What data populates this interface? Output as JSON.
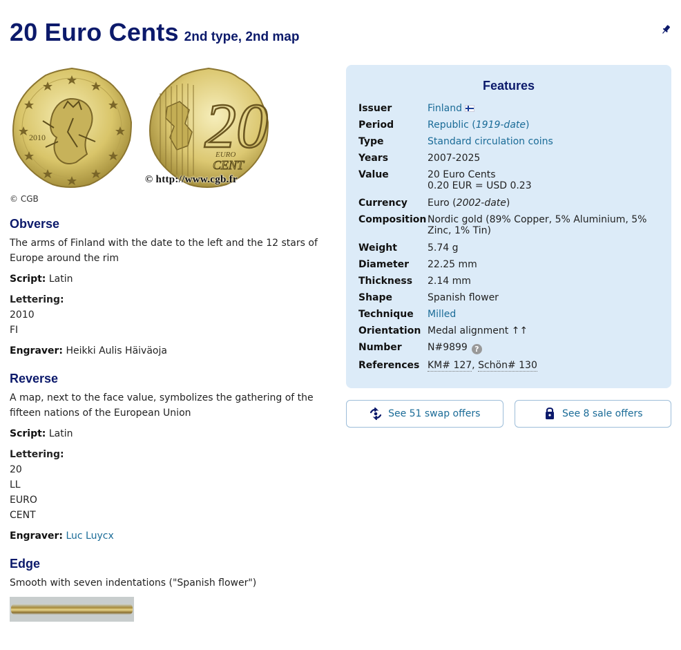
{
  "header": {
    "title": "20 Euro Cents",
    "subtitle": "2nd type, 2nd map"
  },
  "images": {
    "copyright": "© CGB",
    "watermark": "© http://www.cgb.fr",
    "obverse_year": "2010",
    "reverse_value": "20",
    "reverse_word1": "EURO",
    "reverse_word2": "CENT"
  },
  "obverse": {
    "heading": "Obverse",
    "description": "The arms of Finland with the date to the left and the 12 stars of Europe around the rim",
    "script_label": "Script:",
    "script_value": "Latin",
    "lettering_label": "Lettering:",
    "lettering_lines": [
      "2010",
      "FI"
    ],
    "engraver_label": "Engraver:",
    "engraver_value": "Heikki Aulis Häiväoja"
  },
  "reverse": {
    "heading": "Reverse",
    "description": "A map, next to the face value, symbolizes the gathering of the fifteen nations of the European Union",
    "script_label": "Script:",
    "script_value": "Latin",
    "lettering_label": "Lettering:",
    "lettering_lines": [
      "20",
      "LL",
      "EURO",
      "CENT"
    ],
    "engraver_label": "Engraver:",
    "engraver_value": "Luc Luycx"
  },
  "edge": {
    "heading": "Edge",
    "description": "Smooth with seven indentations (\"Spanish flower\")"
  },
  "features": {
    "heading": "Features",
    "issuer_label": "Issuer",
    "issuer_value": "Finland",
    "period_label": "Period",
    "period_value": "Republic (",
    "period_italic": "1919-date",
    "period_close": ")",
    "type_label": "Type",
    "type_value": "Standard circulation coins",
    "years_label": "Years",
    "years_value": "2007-2025",
    "value_label": "Value",
    "value_line1": "20 Euro Cents",
    "value_line2": "0.20 EUR = USD 0.23",
    "currency_label": "Currency",
    "currency_value": "Euro (",
    "currency_italic": "2002-date",
    "currency_close": ")",
    "composition_label": "Composition",
    "composition_value": "Nordic gold (89% Copper, 5% Aluminium, 5% Zinc, 1% Tin)",
    "weight_label": "Weight",
    "weight_value": "5.74 g",
    "diameter_label": "Diameter",
    "diameter_value": "22.25 mm",
    "thickness_label": "Thickness",
    "thickness_value": "2.14 mm",
    "shape_label": "Shape",
    "shape_value": "Spanish flower",
    "technique_label": "Technique",
    "technique_value": "Milled",
    "orientation_label": "Orientation",
    "orientation_value": "Medal alignment ↑↑",
    "number_label": "Number",
    "number_value": "N#9899",
    "number_help": "?",
    "references_label": "References",
    "ref_km": "KM# 127",
    "ref_sep": ", ",
    "ref_schon": "Schön# 130"
  },
  "offers": {
    "swap_label": "See 51 swap offers",
    "sale_label": "See 8 sale offers"
  },
  "colors": {
    "title": "#0c1a6b",
    "link": "#1a6b97",
    "panel_bg": "#dcebf8",
    "coin_gold": "#d8c46a"
  }
}
